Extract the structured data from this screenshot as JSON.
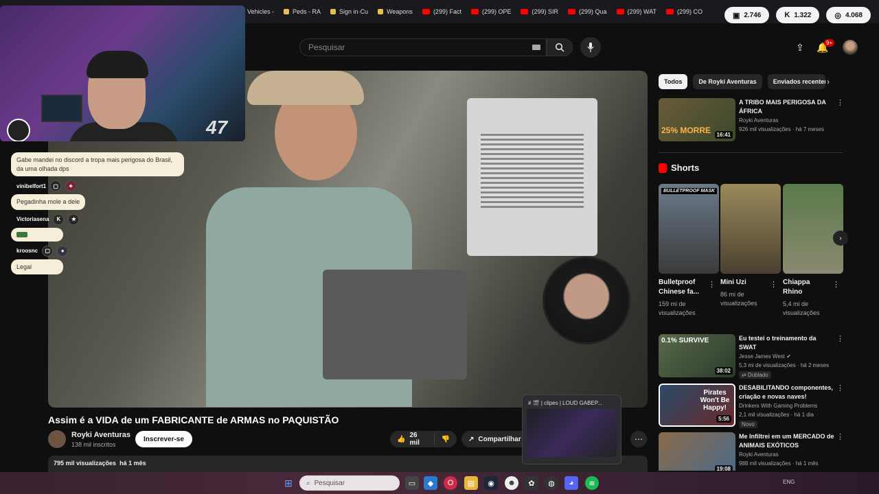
{
  "browser": {
    "bookmarks": [
      {
        "label": "Vehicles -",
        "kind": "plain"
      },
      {
        "label": "Peds - RA",
        "kind": "dot"
      },
      {
        "label": "Sign in·Cu",
        "kind": "dot"
      },
      {
        "label": "Weapons",
        "kind": "dot"
      },
      {
        "label": "(299) Fact",
        "kind": "yt"
      },
      {
        "label": "(299) OPE",
        "kind": "yt"
      },
      {
        "label": "(299) SIR",
        "kind": "yt"
      },
      {
        "label": "(299) Qua",
        "kind": "yt"
      },
      {
        "label": "(299) WAT",
        "kind": "yt"
      },
      {
        "label": "(299) CO",
        "kind": "yt"
      }
    ],
    "counters": [
      {
        "icon": "chat-bubble-icon",
        "glyph": "▣",
        "value": "2.746"
      },
      {
        "icon": "kick-icon",
        "glyph": "K",
        "value": "1.322"
      },
      {
        "icon": "globe-icon",
        "glyph": "◎",
        "value": "4.068"
      }
    ]
  },
  "header": {
    "search_placeholder": "Pesquisar",
    "notif_count": "9+"
  },
  "chat": {
    "messages": [
      {
        "user": "",
        "text": "Gabe mandei no discord a tropa mais perigosa do Brasil, da uma olhada dps"
      },
      {
        "user": "vinibelfort1",
        "text": "Pegadinha mole a dele"
      },
      {
        "user": "Victoriasena",
        "text": ""
      },
      {
        "user": "kroosnc",
        "text": "Legal"
      }
    ]
  },
  "webcam": {
    "counter": "47"
  },
  "video": {
    "title": "Assim é a VIDA de um FABRICANTE de ARMAS no PAQUISTÃO",
    "channel": "Royki Aventuras",
    "subs": "138 mil inscritos",
    "subscribe_label": "Inscrever-se",
    "likes": "26 mil",
    "share_label": "Compartilhar",
    "views": "795 mil visualizações",
    "age": "há 1 mês"
  },
  "popup": {
    "title": "# 🎬 | clipes | LOUD GABEP..."
  },
  "sidebar": {
    "chips": [
      "Todos",
      "De Royki Aventuras",
      "Enviados recentem"
    ],
    "shorts_title": "Shorts",
    "top_video": {
      "title": "A TRIBO MAIS PERIGOSA DA ÁFRICA",
      "channel": "Royki Aventuras",
      "meta": "926 mil visualizações · há 7 meses",
      "duration": "16:41",
      "thumb_text": "25% MORRE"
    },
    "shorts": [
      {
        "title": "Bulletproof Chinese fa...",
        "views": "159 mi de visualizações",
        "thumb_text": "BULLETPROOF MASK"
      },
      {
        "title": "Mini Uzi",
        "views": "86 mi de visualizações",
        "thumb_text": ""
      },
      {
        "title": "Chiappa Rhino",
        "views": "5,4 mi de visualizações",
        "thumb_text": ""
      }
    ],
    "videos": [
      {
        "title": "Eu testei o treinamento da SWAT",
        "channel": "Jesse James West ✔",
        "meta": "5,3 mi de visualizações · há 2 meses",
        "tag": "⇄ Dublado",
        "duration": "38:02",
        "thumb_text": "0.1% SURVIVE"
      },
      {
        "title": "DESABILITANDO componentes, criação e novas naves!",
        "channel": "Drinkers With Gaming Problems",
        "meta": "2,1 mil visualizações · há 1 dia",
        "tag": "Novo",
        "duration": "5:56",
        "thumb_text": "Pirates Won't Be Happy!"
      },
      {
        "title": "Me Infiltrei em um MERCADO de ANIMAIS EXÓTICOS",
        "channel": "Royki Aventuras",
        "meta": "988 mil visualizações · há 1 mês",
        "tag": "",
        "duration": "19:08",
        "thumb_text": ""
      }
    ]
  },
  "taskbar": {
    "search_placeholder": "Pesquisar",
    "tray_text": "ENG"
  }
}
